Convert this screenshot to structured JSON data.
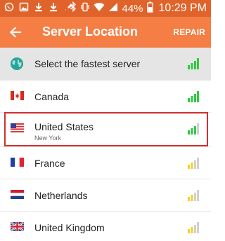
{
  "status_bar": {
    "battery_percent": "44%",
    "time": "10:29 PM",
    "left_icons": [
      "whatsapp-icon",
      "image-icon",
      "download-icon",
      "download-icon",
      "vpn-key-icon"
    ],
    "right_icons": [
      "bluetooth-icon",
      "vibrate-icon",
      "wifi-icon",
      "signal-icon",
      "battery-icon"
    ]
  },
  "app_bar": {
    "title": "Server Location",
    "action": "REPAIR",
    "back_icon": "arrow-back-icon",
    "color": "#f57e44"
  },
  "servers": [
    {
      "name": "Select the fastest server",
      "icon": "globe-icon",
      "signal": "strong",
      "signal_color": "#2ecc40"
    },
    {
      "name": "Canada",
      "icon": "canada-flag-icon",
      "signal": "strong",
      "signal_color": "#2ecc40"
    },
    {
      "name": "United States",
      "city": "New York",
      "icon": "usa-flag-icon",
      "signal": "medium",
      "signal_color": "#2ecc40",
      "selected": true
    },
    {
      "name": "France",
      "icon": "france-flag-icon",
      "signal": "weak",
      "signal_color": "#f5d020"
    },
    {
      "name": "Netherlands",
      "icon": "netherlands-flag-icon",
      "signal": "weak",
      "signal_color": "#f5d020"
    },
    {
      "name": "United Kingdom",
      "icon": "uk-flag-icon",
      "signal": "weak",
      "signal_color": "#f5d020"
    }
  ],
  "highlight_color": "#d32f2f"
}
